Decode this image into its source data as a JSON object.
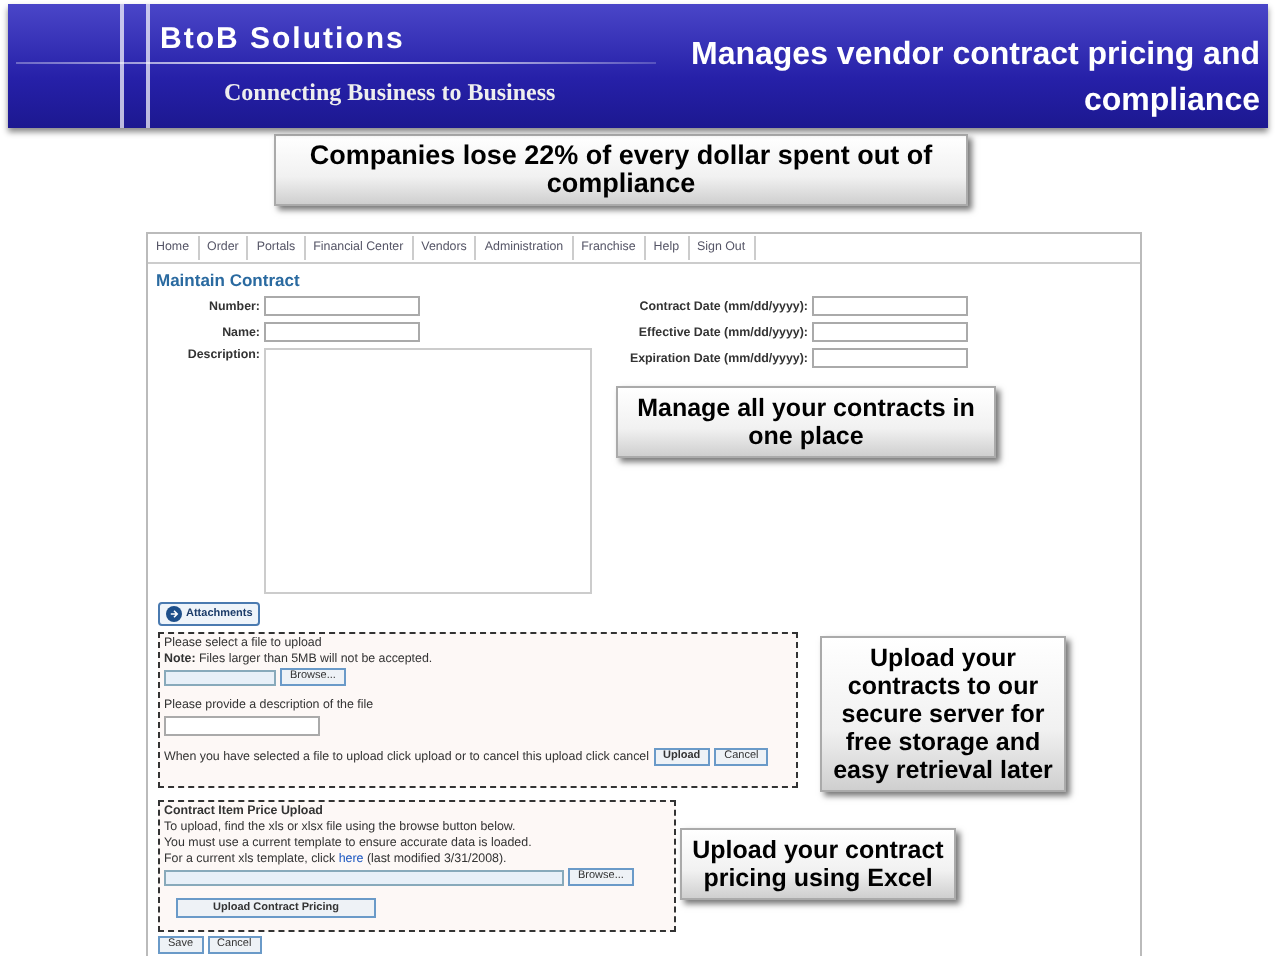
{
  "header": {
    "brand": "BtoB Solutions",
    "tagline": "Connecting Business to Business",
    "title": "Manages vendor contract pricing and compliance"
  },
  "top_callout": "Companies lose 22% of every dollar spent out of compliance",
  "app": {
    "nav": [
      "Home",
      "Order",
      "Portals",
      "Financial Center",
      "Vendors",
      "Administration",
      "Franchise",
      "Help",
      "Sign Out"
    ],
    "page_title": "Maintain Contract",
    "left_fields": [
      {
        "label": "Number:"
      },
      {
        "label": "Name:"
      }
    ],
    "description_label": "Description:",
    "right_fields": [
      {
        "label": "Contract Date (mm/dd/yyyy):"
      },
      {
        "label": "Effective Date (mm/dd/yyyy):"
      },
      {
        "label": "Expiration Date (mm/dd/yyyy):"
      }
    ],
    "attachments_button": "Attachments",
    "attachment_panel": {
      "prompt": "Please select a file to upload",
      "note": "**Note:** Files larger than 5MB will not be accepted.",
      "browse": "Browse...",
      "description_prompt": "Please provide a description of the file",
      "instruction": "When you have selected a file to upload click upload or to cancel this upload click cancel",
      "upload": "Upload",
      "cancel": "Cancel"
    },
    "price_upload": {
      "title": "Contract Item Price Upload",
      "lines": [
        "To upload, find the xls or xlsx file using the browse button below.",
        "You must use a current template to ensure accurate data is loaded."
      ],
      "link_before": "For a current xls template, click ",
      "link": "here",
      "link_after": " (last modified 3/31/2008).",
      "browse": "Browse...",
      "button": "Upload Contract Pricing"
    },
    "footer_buttons": [
      "Save",
      "Cancel"
    ]
  },
  "callouts": [
    {
      "text": "Manage all your contracts in one place"
    },
    {
      "text": "Upload your contracts to our secure server for free storage and easy retrieval later"
    },
    {
      "text": "Upload your contract pricing using Excel"
    }
  ]
}
